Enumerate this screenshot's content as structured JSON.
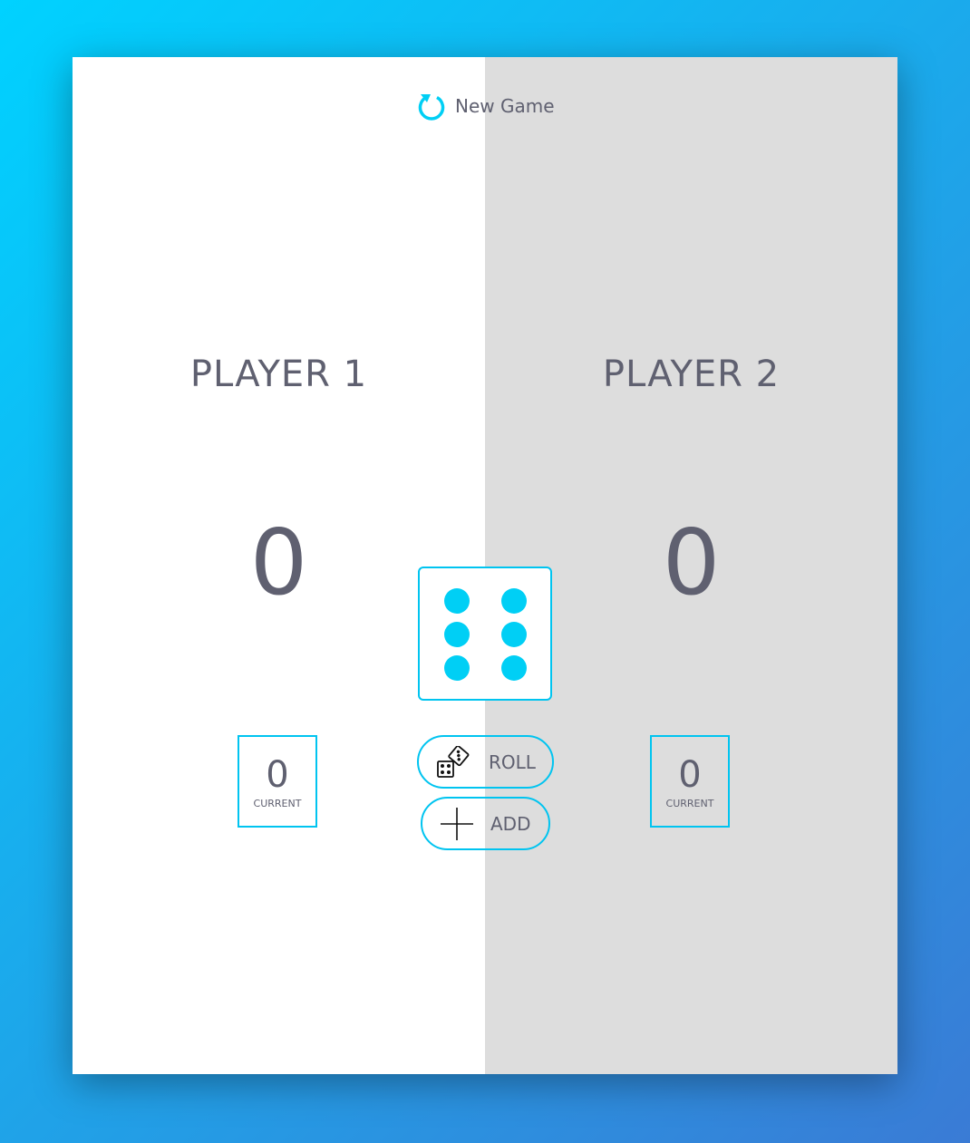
{
  "header": {
    "new_game_label": "New Game",
    "new_game_icon": "refresh-icon"
  },
  "players": [
    {
      "name": "PLAYER 1",
      "total": "0",
      "current": "0",
      "current_label": "CURRENT",
      "active": true
    },
    {
      "name": "PLAYER 2",
      "total": "0",
      "current": "0",
      "current_label": "CURRENT",
      "active": false
    }
  ],
  "dice": {
    "value": 6,
    "pip_color": "#00cff5"
  },
  "controls": {
    "roll_label": "ROLL",
    "roll_icon": "dice-icon",
    "add_label": "ADD",
    "add_icon": "plus-icon"
  },
  "colors": {
    "accent": "#00c4f0",
    "text": "#5f6070",
    "active_panel": "#ffffff",
    "inactive_panel": "#dddddd"
  }
}
